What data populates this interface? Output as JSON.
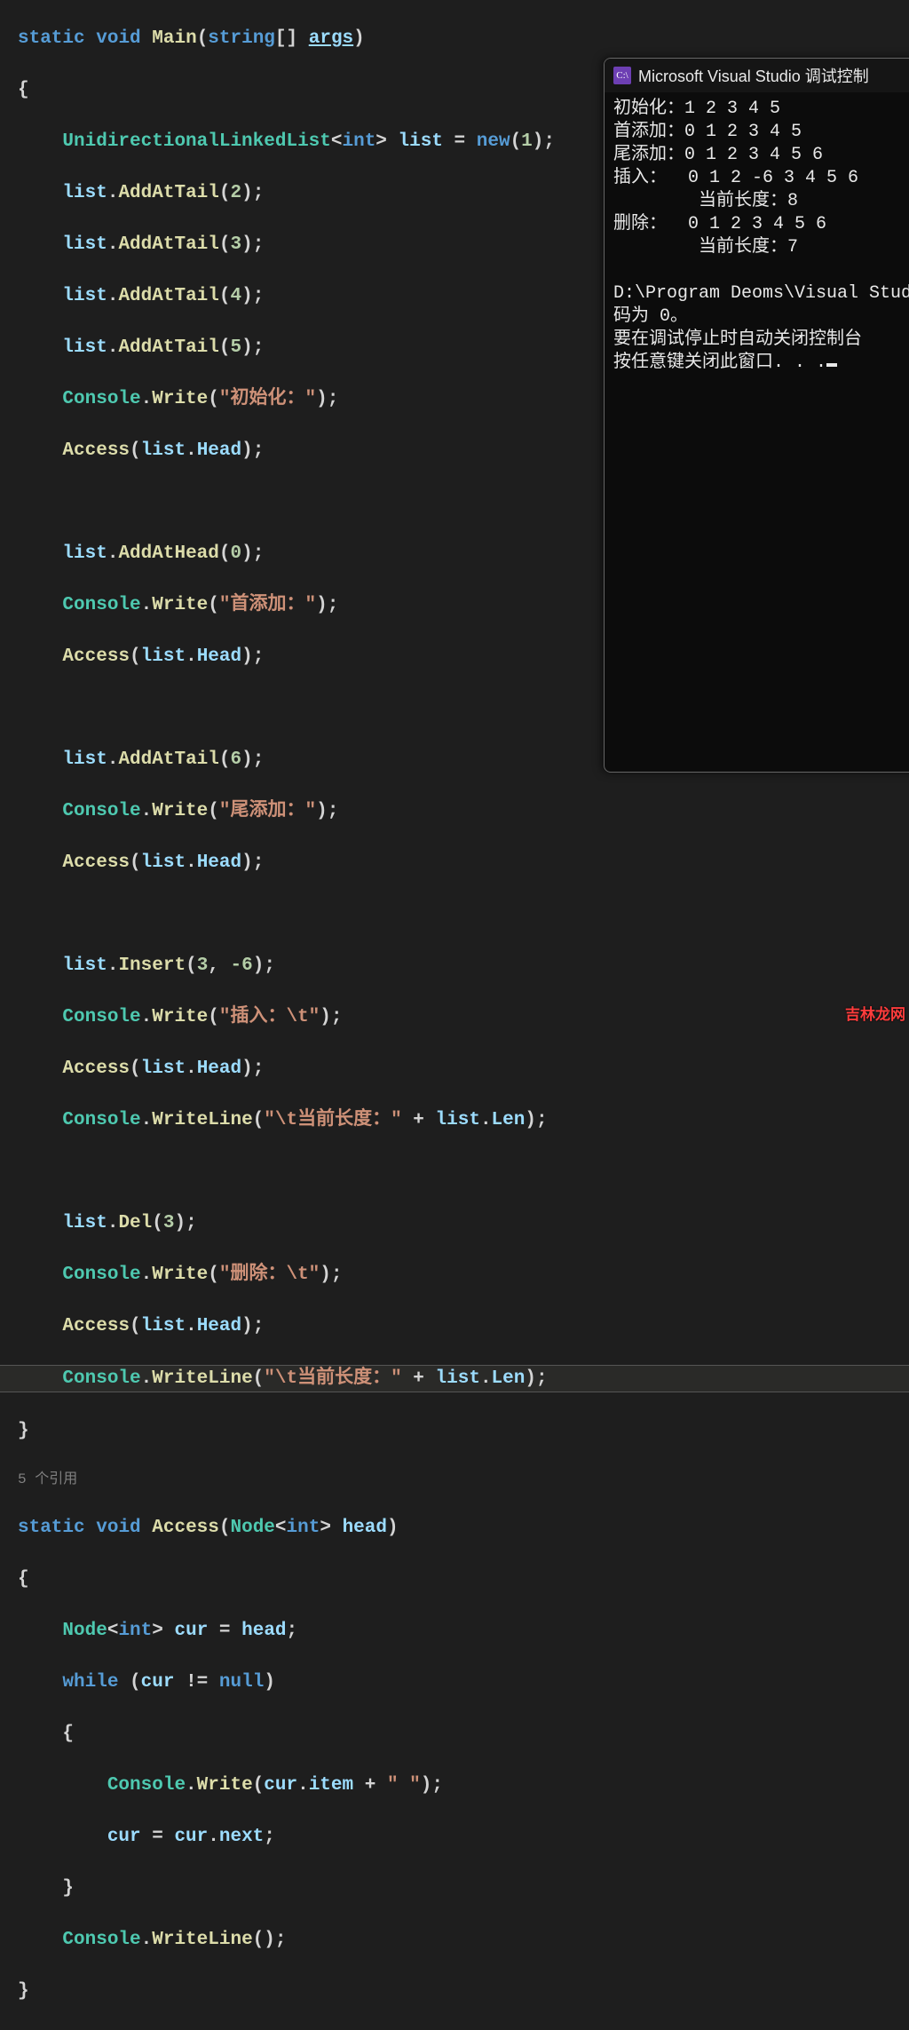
{
  "code": {
    "l1": {
      "static": "static",
      "void": "void",
      "main": "Main",
      "args_t": "string",
      "args": "args"
    },
    "l3": {
      "ull": "UnidirectionalLinkedList",
      "int": "int",
      "list": "list",
      "new": "new",
      "n1": "1"
    },
    "l4": {
      "list": "list",
      "fn": "AddAtTail",
      "n": "2"
    },
    "l5": {
      "list": "list",
      "fn": "AddAtTail",
      "n": "3"
    },
    "l6": {
      "list": "list",
      "fn": "AddAtTail",
      "n": "4"
    },
    "l7": {
      "list": "list",
      "fn": "AddAtTail",
      "n": "5"
    },
    "l8": {
      "cls": "Console",
      "fn": "Write",
      "s": "\"初始化：\""
    },
    "l9": {
      "fn": "Access",
      "list": "list",
      "head": "Head"
    },
    "l11": {
      "list": "list",
      "fn": "AddAtHead",
      "n": "0"
    },
    "l12": {
      "cls": "Console",
      "fn": "Write",
      "s": "\"首添加：\""
    },
    "l13": {
      "fn": "Access",
      "list": "list",
      "head": "Head"
    },
    "l15": {
      "list": "list",
      "fn": "AddAtTail",
      "n": "6"
    },
    "l16": {
      "cls": "Console",
      "fn": "Write",
      "s": "\"尾添加：\""
    },
    "l17": {
      "fn": "Access",
      "list": "list",
      "head": "Head"
    },
    "l19": {
      "list": "list",
      "fn": "Insert",
      "a": "3",
      "b": "-6"
    },
    "l20": {
      "cls": "Console",
      "fn": "Write",
      "s": "\"插入：\\t\""
    },
    "l21": {
      "fn": "Access",
      "list": "list",
      "head": "Head"
    },
    "l22": {
      "cls": "Console",
      "fn": "WriteLine",
      "s": "\"\\t当前长度：\"",
      "list": "list",
      "len": "Len"
    },
    "l24": {
      "list": "list",
      "fn": "Del",
      "n": "3"
    },
    "l25": {
      "cls": "Console",
      "fn": "Write",
      "s": "\"删除：\\t\""
    },
    "l26": {
      "fn": "Access",
      "list": "list",
      "head": "Head"
    },
    "l27": {
      "cls": "Console",
      "fn": "WriteLine",
      "s": "\"\\t当前长度：\"",
      "list": "list",
      "len": "Len"
    },
    "codelens": "5 个引用",
    "l30": {
      "static": "static",
      "void": "void",
      "name": "Access",
      "node": "Node",
      "int": "int",
      "head": "head"
    },
    "l32": {
      "node": "Node",
      "int": "int",
      "cur": "cur",
      "head": "head"
    },
    "l33": {
      "while": "while",
      "cur": "cur",
      "nul": "null"
    },
    "l35": {
      "cls": "Console",
      "fn": "Write",
      "cur": "cur",
      "item": "item",
      "s": "\" \""
    },
    "l36": {
      "cur": "cur",
      "next": "next"
    },
    "l38": {
      "cls": "Console",
      "fn": "WriteLine"
    }
  },
  "console": {
    "title": "Microsoft Visual Studio 调试控制",
    "lines": [
      "初始化：1 2 3 4 5",
      "首添加：0 1 2 3 4 5",
      "尾添加：0 1 2 3 4 5 6",
      "插入：  0 1 2 -6 3 4 5 6",
      "        当前长度：8",
      "删除：  0 1 2 3 4 5 6",
      "        当前长度：7",
      "",
      "D:\\Program Deoms\\Visual Stud",
      "码为 0。",
      "要在调试停止时自动关闭控制台",
      "按任意键关闭此窗口. . ."
    ]
  },
  "watermark": "吉林龙网"
}
